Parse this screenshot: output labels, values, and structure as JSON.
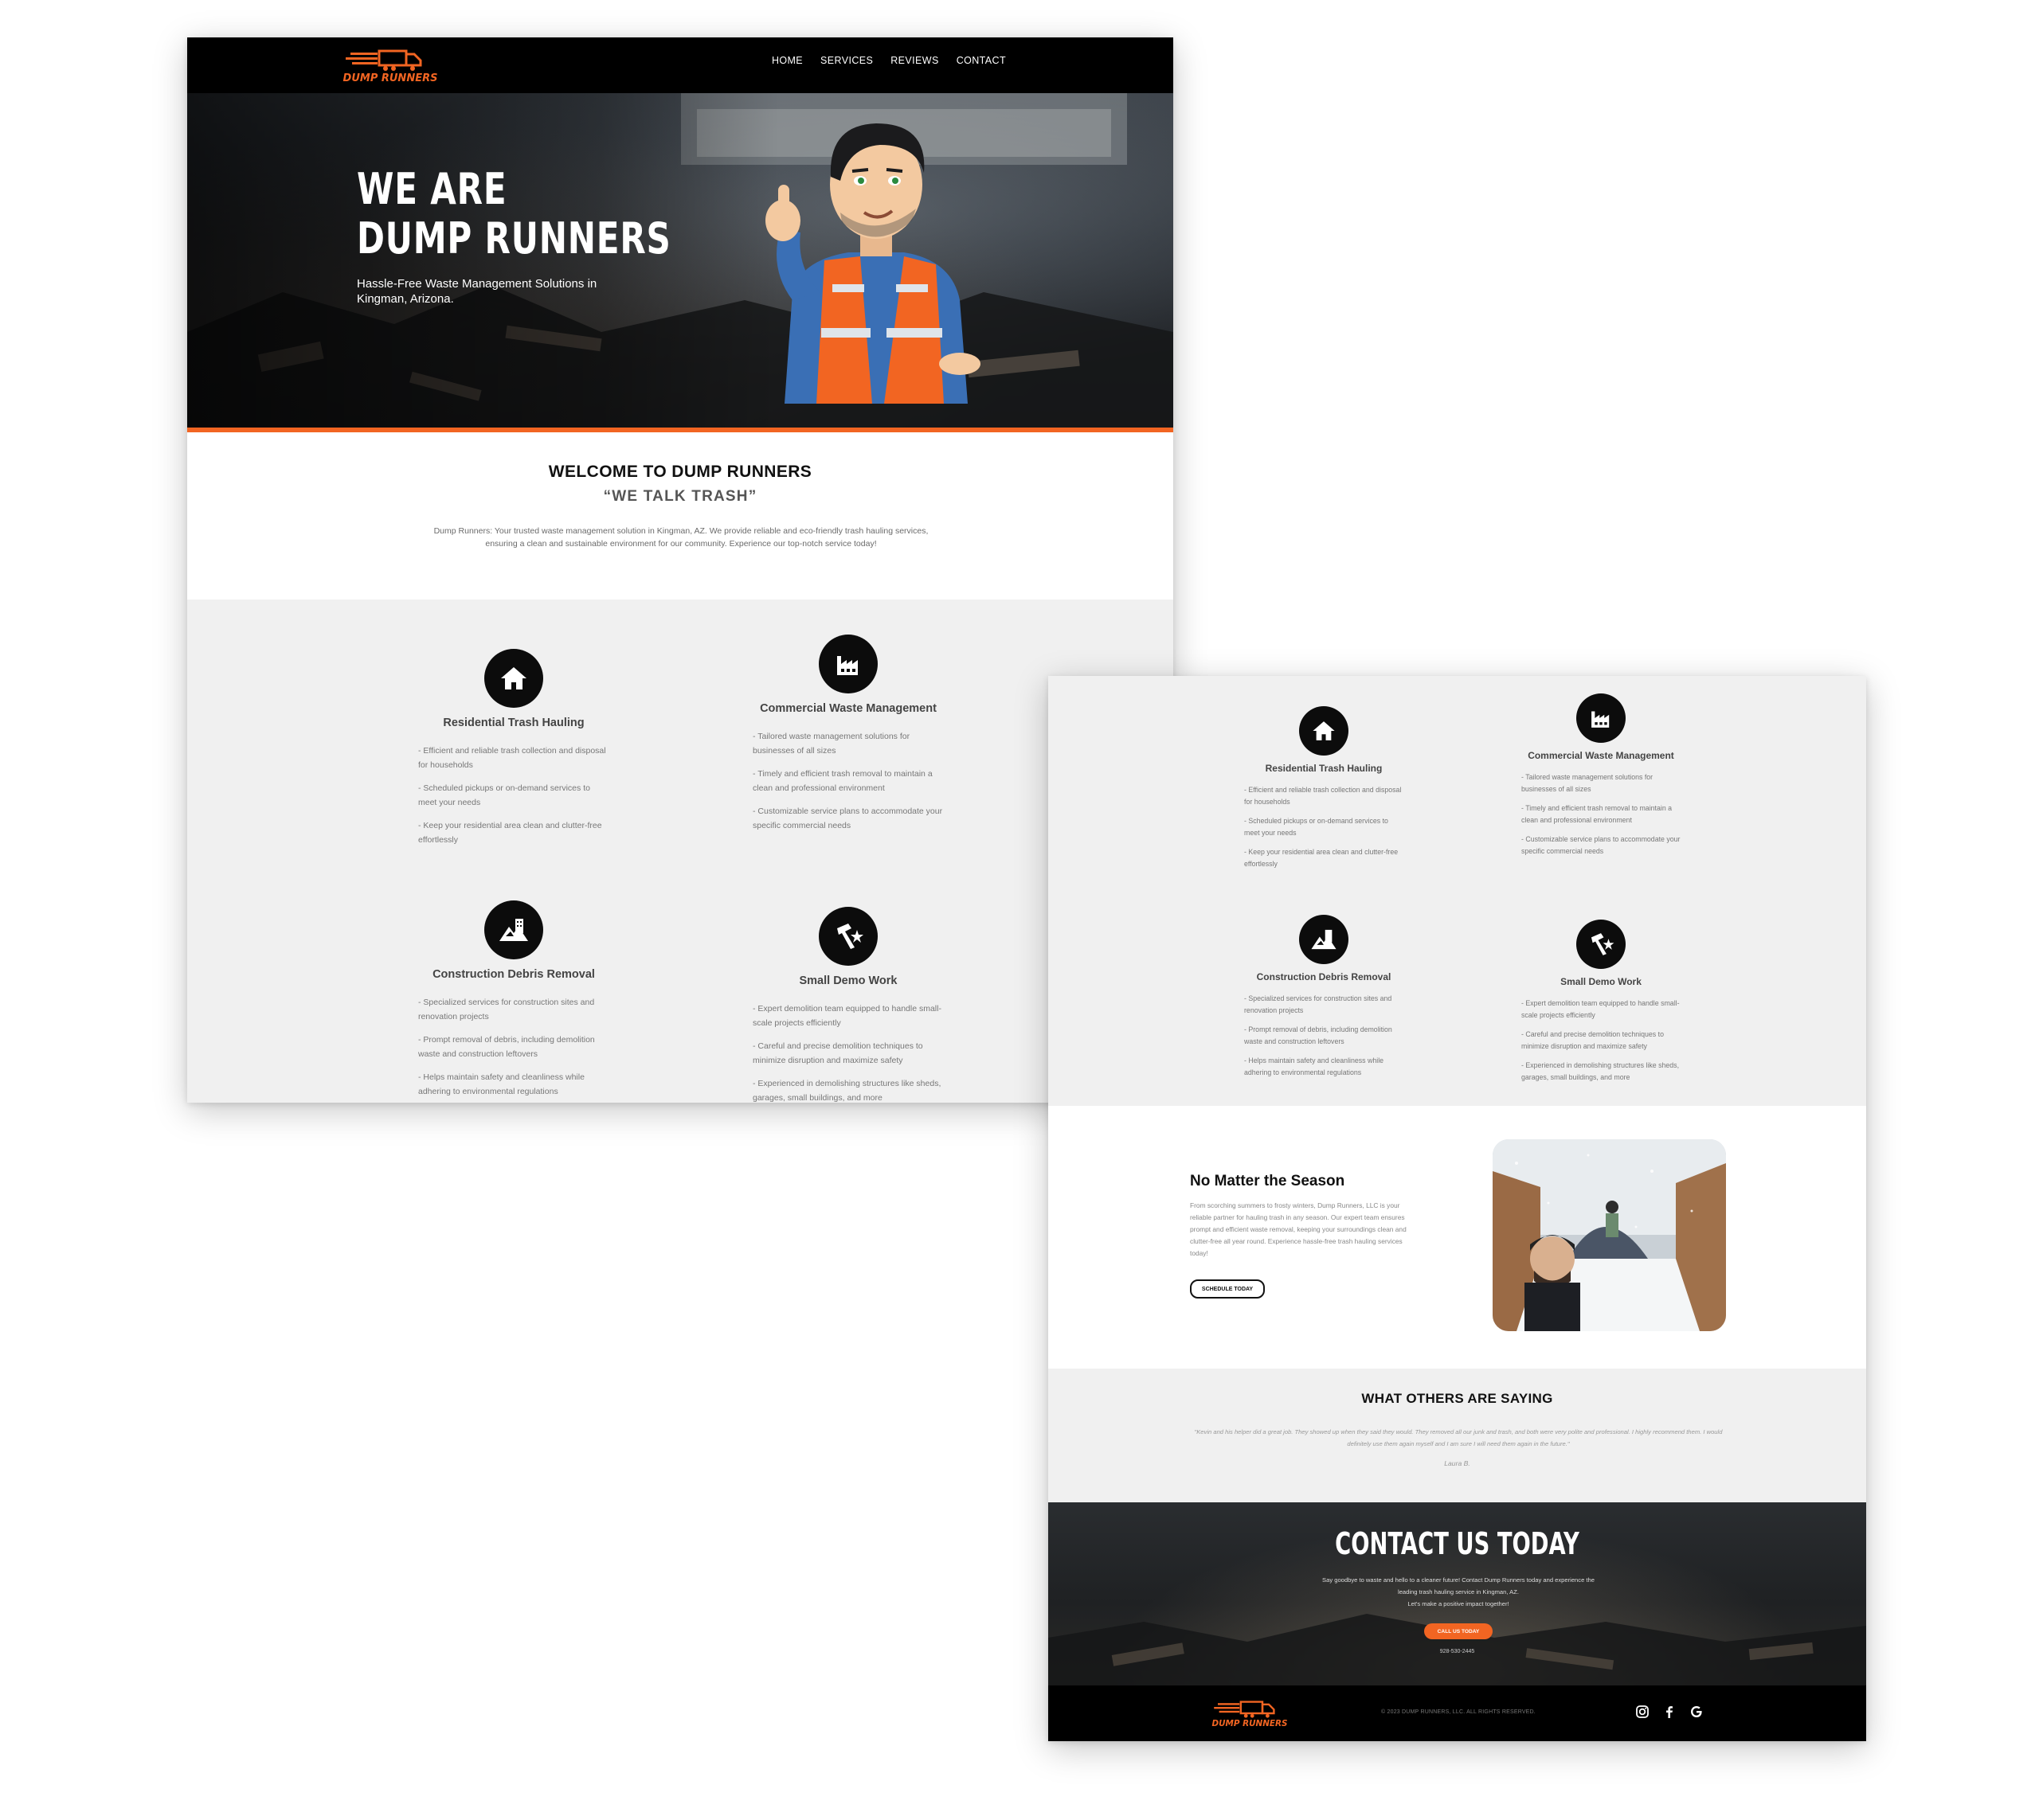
{
  "brand": {
    "logo_text": "DUMP RUNNERS",
    "accent": "#f26522",
    "dark": "#000000"
  },
  "nav": [
    "HOME",
    "SERVICES",
    "REVIEWS",
    "CONTACT"
  ],
  "hero": {
    "title_line1": "WE ARE",
    "title_line2": "DUMP RUNNERS",
    "subtitle": "Hassle-Free Waste Management Solutions in Kingman, Arizona."
  },
  "welcome": {
    "title": "WELCOME TO DUMP RUNNERS",
    "tagline": "“WE TALK TRASH”",
    "body": "Dump Runners: Your trusted waste management solution in Kingman, AZ. We provide reliable and eco-friendly trash hauling services, ensuring a clean and sustainable environment for our community. Experience our top-notch service today!"
  },
  "services": [
    {
      "icon": "house-icon",
      "title": "Residential Trash Hauling",
      "points": [
        "- Efficient and reliable trash collection and disposal for households",
        "- Scheduled pickups or on-demand services to meet your needs",
        "- Keep your residential area clean and clutter-free effortlessly"
      ]
    },
    {
      "icon": "factory-icon",
      "title": "Commercial Waste Management",
      "points": [
        "- Tailored waste management solutions for businesses of all sizes",
        "- Timely and efficient trash removal to maintain a clean and professional environment",
        "- Customizable service plans to accommodate your specific commercial needs"
      ]
    },
    {
      "icon": "debris-icon",
      "title": "Construction Debris Removal",
      "points": [
        "- Specialized services for construction sites and renovation projects",
        "- Prompt removal of debris, including demolition waste and construction leftovers",
        "- Helps maintain safety and cleanliness while adhering to environmental regulations"
      ]
    },
    {
      "icon": "hammer-icon",
      "title": "Small Demo Work",
      "points": [
        "- Expert demolition team equipped to handle small-scale projects efficiently",
        "- Careful and precise demolition techniques to minimize disruption and maximize safety",
        "- Experienced in demolishing structures like sheds, garages, small buildings, and more"
      ]
    }
  ],
  "season": {
    "title": "No Matter the Season",
    "body": "From scorching summers to frosty winters, Dump Runners, LLC is your reliable partner for hauling trash in any season. Our expert team ensures prompt and efficient waste removal, keeping your surroundings clean and clutter-free all year round. Experience hassle-free trash hauling services today!",
    "button": "SCHEDULE TODAY"
  },
  "reviews": {
    "title": "WHAT OTHERS ARE SAYING",
    "quote": "\"Kevin and his helper did a great job. They showed up when they said they would. They removed all our junk and trash, and both were very polite and professional. I highly recommend them. I would definitely use them again myself and I am sure I will need them again in the future.\"",
    "author": "Laura B."
  },
  "contact": {
    "title": "CONTACT US TODAY",
    "body_line1": "Say goodbye to waste and hello to a cleaner future! Contact Dump Runners today and experience the leading trash hauling service in Kingman, AZ.",
    "body_line2": "Let's make a positive impact together!",
    "button": "CALL US TODAY",
    "phone": "928-530-2445"
  },
  "footer": {
    "copyright": "© 2023 Dump Runners, LLC. ALL RIGHTS RESERVED.",
    "social": [
      "instagram-icon",
      "facebook-icon",
      "google-icon"
    ]
  }
}
